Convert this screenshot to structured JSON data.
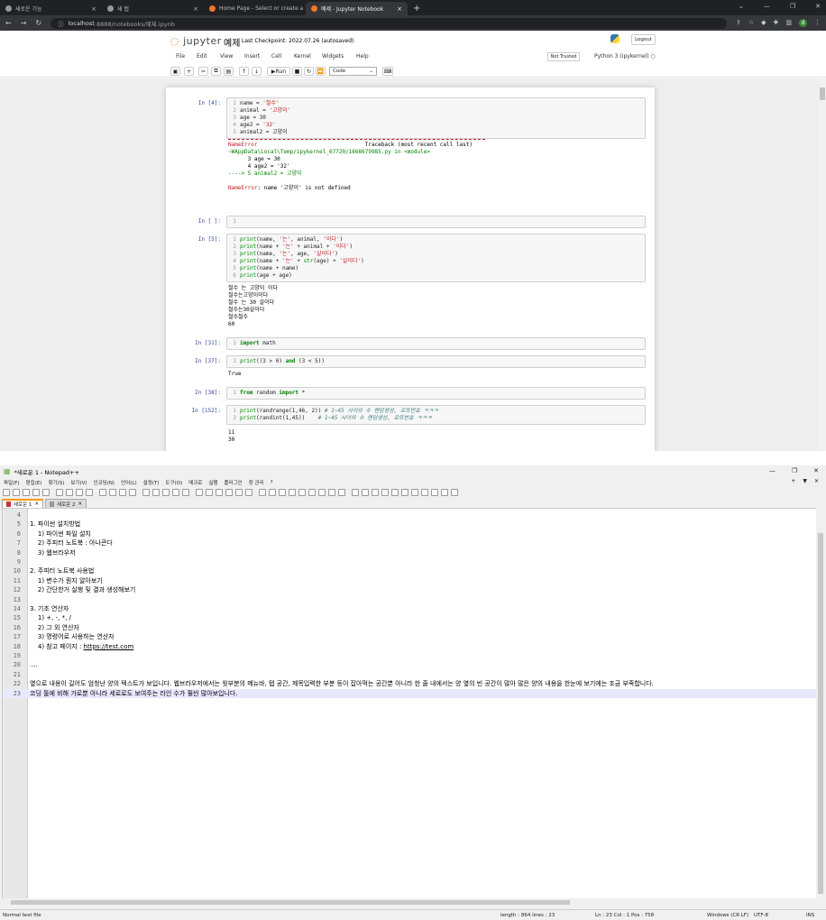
{
  "browser": {
    "tabs": [
      {
        "label": "새로운 기능"
      },
      {
        "label": "새 탭"
      },
      {
        "label": "Home Page - Select or create a"
      },
      {
        "label": "예제 - Jupyter Notebook"
      }
    ],
    "url_host": "localhost",
    "url_path": ":8888/notebooks/예제.ipynb",
    "profile_initial": "d"
  },
  "jupyter": {
    "logo_text": "jupyter",
    "notebook_name": "예제",
    "checkpoint": "Last Checkpoint: 2022.07.26   (autosaved)",
    "logout_label": "Logout",
    "menus": [
      "File",
      "Edit",
      "View",
      "Insert",
      "Cell",
      "Kernel",
      "Widgets",
      "Help"
    ],
    "trusted": "Not Trusted",
    "kernel": "Python 3 (ipykernel)",
    "run_label": "Run",
    "cell_type": "Code",
    "cells": [
      {
        "prompt": "In [4]:",
        "lines": [
          "name = '철수'",
          "animal = '고양이'",
          "age = 30",
          "age2 = '32'",
          "animal2 = 고양이"
        ],
        "output": [
          "NameError                                 Traceback (most recent call last)",
          "~WAppData\\Local\\Temp/ipykernel_67720/1668679985.py in <module>",
          "      3 age = 30",
          "      4 age2 = '32'",
          "----> 5 animal2 = 고양이",
          "",
          "NameError: name '고양이' is not defined"
        ]
      },
      {
        "prompt": "In [ ]:",
        "lines": [
          ""
        ],
        "output": []
      },
      {
        "prompt": "In [5]:",
        "lines": [
          "print(name, '는', animal, '이다')",
          "print(name + '는' + animal + '이다')",
          "print(name, '는', age, '살이다')",
          "print(name + '는' + str(age) + '살이다')",
          "print(name + name)",
          "print(age + age)"
        ],
        "output": [
          "철수 는 고양이 이다",
          "철수는고양이이다",
          "철수 는 30 살이다",
          "철수는30살이다",
          "철수철수",
          "60"
        ]
      },
      {
        "prompt": "In [31]:",
        "lines": [
          "import math"
        ],
        "output": []
      },
      {
        "prompt": "In [37]:",
        "lines": [
          "print((3 > 0) and (3 < 5))"
        ],
        "output": [
          "True"
        ]
      },
      {
        "prompt": "In [38]:",
        "lines": [
          "from random import *"
        ],
        "output": []
      },
      {
        "prompt": "In [152]:",
        "lines": [
          "print(randrange(1,46, 2)) # 1~45 사이의 수 랜덤생성, 로또번호 ㅋㅋㅋ",
          "print(randint(1,45))    # 1~45 사이의 수 랜덤생성, 로또번호 ㅋㅋㅋ"
        ],
        "output": [
          "11",
          "30"
        ]
      }
    ]
  },
  "notepad": {
    "title": "*새로운 1 - Notepad++",
    "menus": [
      "파일(F)",
      "편집(E)",
      "찾기(S)",
      "보기(V)",
      "인코딩(N)",
      "언어(L)",
      "설정(T)",
      "도구(O)",
      "매크로",
      "실행",
      "플러그인",
      "창 관리",
      "?"
    ],
    "tabs": [
      "새로운 1",
      "새로운 2"
    ],
    "lines": [
      {
        "n": "4",
        "t": ""
      },
      {
        "n": "5",
        "t": "1. 파이썬 설치방법"
      },
      {
        "n": "6",
        "t": "    1) 파이썬 파일 설치"
      },
      {
        "n": "7",
        "t": "    2) 주피터 노트북 : 아나콘다"
      },
      {
        "n": "8",
        "t": "    3) 웹브라우저"
      },
      {
        "n": "9",
        "t": ""
      },
      {
        "n": "10",
        "t": "2. 주피터 노트북 사용법"
      },
      {
        "n": "11",
        "t": "    1) 변수가 뭔지 알아보기"
      },
      {
        "n": "12",
        "t": "    2) 간단한거 실행 및 결과 생성해보기"
      },
      {
        "n": "13",
        "t": ""
      },
      {
        "n": "14",
        "t": "3. 기초 연산자"
      },
      {
        "n": "15",
        "t": "    1) +, -, *, /"
      },
      {
        "n": "16",
        "t": "    2) 그 외 연산자"
      },
      {
        "n": "17",
        "t": "    3) 명령어로 사용하는 연산자"
      },
      {
        "n": "18",
        "t": "    4) 참고 페이지 : ",
        "link": "https://test.com"
      },
      {
        "n": "19",
        "t": ""
      },
      {
        "n": "20",
        "t": "...."
      },
      {
        "n": "21",
        "t": ""
      },
      {
        "n": "22",
        "t": "옆으로 내용이 길어도 엄청난 양의 텍스트가 보입니다. 웹브라우저에서는 윗부분의 메뉴바, 탭 공간, 제목입력한 부분 등이 잡아먹는 공간뿐 아니라 한 줄 내에서는 양 옆의 빈 공간이 많아 많은 양의 내용을 한눈에 보기에는 조금 부족합니다."
      },
      {
        "n": "23",
        "t": "코딩 툴에 비해 가로뿐 아니라 세로로도 보여주는 라인 수가 훨씬 많아보입니다."
      }
    ],
    "status": {
      "type": "Normal text file",
      "length": "length : 864   lines : 23",
      "pos": "Ln : 23    Col : 1    Pos : 758",
      "eol": "Windows (CR LF)",
      "enc": "UTF-8",
      "mode": "INS"
    }
  }
}
